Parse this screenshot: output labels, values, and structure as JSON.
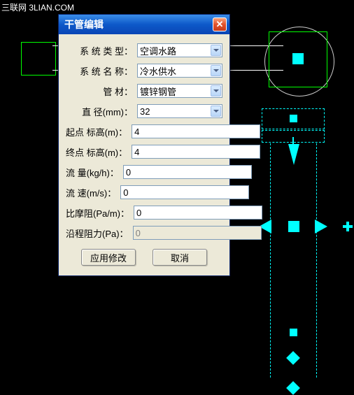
{
  "watermark": "三联网 3LIAN.COM",
  "dialog": {
    "title": "干管编辑",
    "close_symbol": "✕",
    "fields": {
      "system_type": {
        "label": "系 统  类 型：",
        "value": "空调水路",
        "type": "select"
      },
      "system_name": {
        "label": "系 统  名 称：",
        "value": "冷水供水",
        "type": "select"
      },
      "material": {
        "label": "管    材：",
        "value": "镀锌钢管",
        "type": "select"
      },
      "diameter": {
        "label": "直    径(mm)：",
        "value": "32",
        "type": "select"
      },
      "start_elev": {
        "label": "起点 标高(m)：",
        "value": "4",
        "type": "input"
      },
      "end_elev": {
        "label": "终点 标高(m)：",
        "value": "4",
        "type": "input"
      },
      "flow": {
        "label": "流   量(kg/h)：",
        "value": "0",
        "type": "input"
      },
      "velocity": {
        "label": "流   速(m/s)：",
        "value": "0",
        "type": "input"
      },
      "friction": {
        "label": "比摩阻(Pa/m)：",
        "value": "0",
        "type": "input"
      },
      "along_loss": {
        "label": "沿程阻力(Pa)：",
        "value": "0",
        "type": "input",
        "disabled": true
      }
    },
    "buttons": {
      "apply": "应用修改",
      "cancel": "取消"
    }
  }
}
